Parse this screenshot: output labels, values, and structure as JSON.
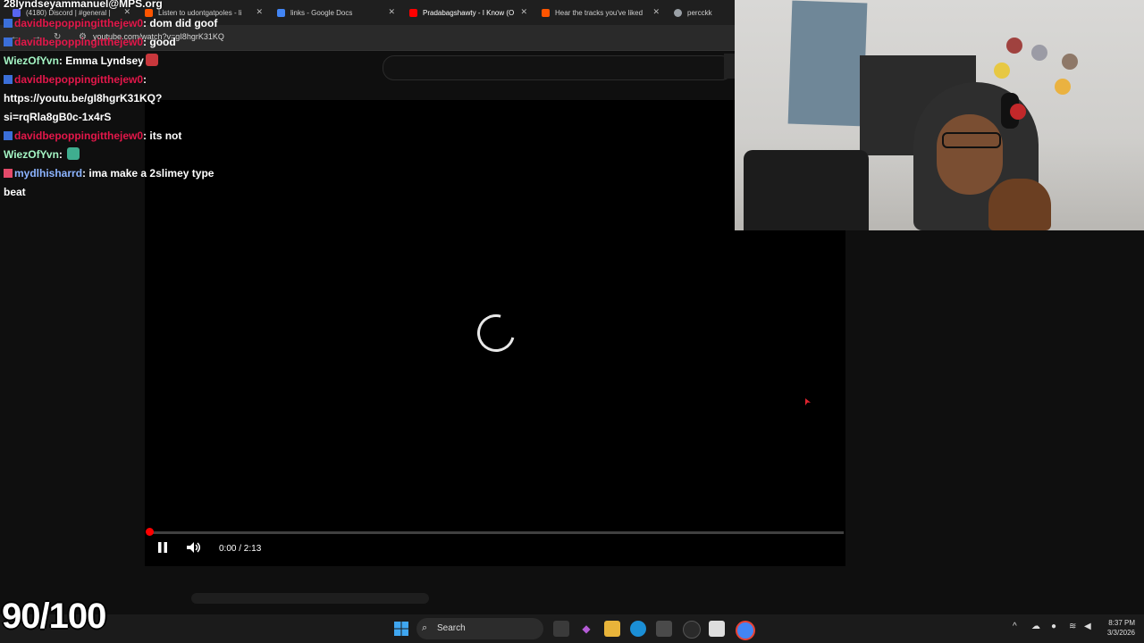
{
  "browser": {
    "tabs": [
      {
        "label": "(4180) Discord | #general |",
        "color": "#5865f2"
      },
      {
        "label": "Listen to udontgatpoles - li",
        "color": "#ff5500"
      },
      {
        "label": "links - Google Docs",
        "color": "#4285f4"
      },
      {
        "label": "Pradabagshawty - I Know (O",
        "color": "#ff0000"
      },
      {
        "label": "Hear the tracks you've liked",
        "color": "#ff5500"
      },
      {
        "label": "percckk",
        "color": "#9aa0a6"
      }
    ],
    "url": "youtube.com/watch?v=gI8hgrK31KQ"
  },
  "stream_overlay": {
    "email": "28lyndseyammanuel@MPS.org",
    "score": "90/100"
  },
  "chat": {
    "messages": [
      {
        "user": "davidbepoppingitthejew0",
        "user_color": "red",
        "text": "dom did goof"
      },
      {
        "user": "davidbepoppingitthejew0",
        "user_color": "red",
        "text": "good"
      },
      {
        "user": "WiezOfYvn",
        "user_color": "green",
        "text": "Emma Lyndsey"
      },
      {
        "user": "davidbepoppingitthejew0",
        "user_color": "red",
        "text": ""
      },
      {
        "user": "",
        "user_color": "",
        "text": "https://youtu.be/gI8hgrK31KQ?"
      },
      {
        "user": "",
        "user_color": "",
        "text": "si=rqRla8gB0c-1x4rS"
      },
      {
        "user": "davidbepoppingitthejew0",
        "user_color": "red",
        "text": "its not"
      },
      {
        "user": "WiezOfYvn",
        "user_color": "green",
        "text": ""
      },
      {
        "user": "mydlhisharrd",
        "user_color": "blue",
        "text": "ima make a 2slimey type"
      },
      {
        "user": "",
        "user_color": "",
        "text": "beat"
      }
    ]
  },
  "video": {
    "time": "0:00 / 2:13",
    "progress_fraction": 0.0,
    "state": "loading"
  },
  "taskbar": {
    "search_label": "Search",
    "time": "8:37 PM",
    "date": "3/3/2026"
  },
  "colors": {
    "accent_red": "#ff0000",
    "chat_red": "#e3174a",
    "chat_green": "#a4f5c4",
    "chat_blue": "#8cb4ff"
  }
}
